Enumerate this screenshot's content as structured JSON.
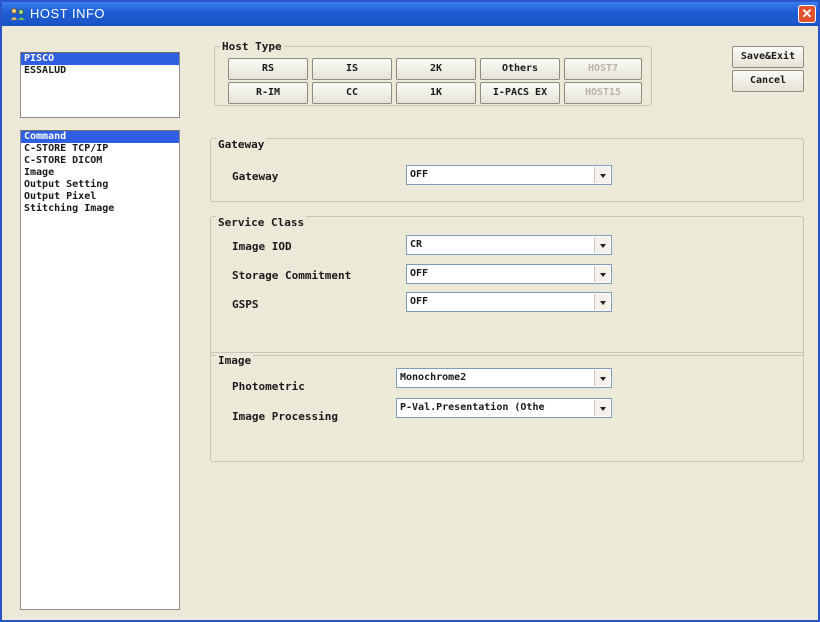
{
  "window": {
    "title": "HOST INFO",
    "close_glyph": "✕"
  },
  "hosts": [
    "PISCO",
    "ESSALUD"
  ],
  "menu": [
    "Command",
    "C-STORE TCP/IP",
    "C-STORE DICOM",
    "Image",
    "Output Setting",
    "Output Pixel",
    "Stitching Image"
  ],
  "host_type": {
    "label": "Host Type",
    "buttons": [
      "RS",
      "IS",
      "2K",
      "Others",
      "HOST7",
      "R-IM",
      "CC",
      "1K",
      "I-PACS EX",
      "HOST15"
    ]
  },
  "actions": {
    "save_exit": "Save&Exit",
    "cancel": "Cancel"
  },
  "gateway": {
    "group": "Gateway",
    "label": "Gateway",
    "value": "OFF"
  },
  "service_class": {
    "group": "Service Class",
    "image_iod_label": "Image IOD",
    "image_iod_value": "CR",
    "storage_label": "Storage Commitment",
    "storage_value": "OFF",
    "gsps_label": "GSPS",
    "gsps_value": "OFF"
  },
  "image": {
    "group": "Image",
    "photometric_label": "Photometric",
    "photometric_value": "Monochrome2",
    "processing_label": "Image Processing",
    "processing_value": "P-Val.Presentation (Othe"
  },
  "colors": {
    "titlebar": "#1f5fd6",
    "selection": "#2f5fe0",
    "close": "#e0522b"
  },
  "icons": [
    "host-info-app-icon",
    "close-icon",
    "chevron-down-icon"
  ]
}
